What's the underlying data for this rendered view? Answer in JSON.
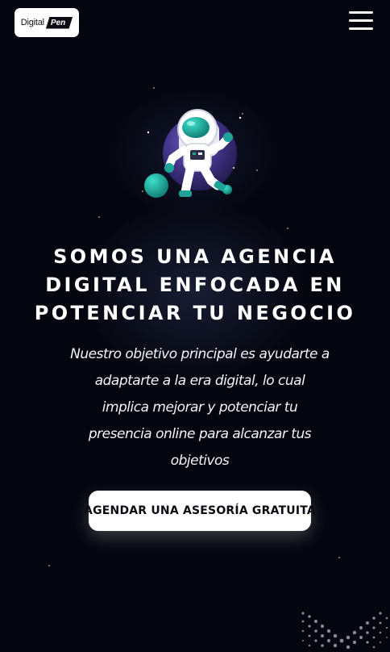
{
  "header": {
    "logo_text": "Digital",
    "logo_mark": "Pen",
    "menu_icon": "hamburger-menu-icon"
  },
  "hero": {
    "illustration": "astronaut-illustration",
    "headline_lines": [
      "SOMOS UNA AGENCIA",
      "DIGITAL ENFOCADA EN",
      "POTENCIAR TU NEGOCIO"
    ],
    "paragraph_lines": [
      "Nuestro objetivo principal es ayudarte a",
      "adaptarte a la era digital, lo cual",
      "implica mejorar y potenciar tu",
      "presencia online para alcanzar tus",
      "objetivos"
    ],
    "cta_label": "AGENDAR UNA ASESORÍA GRATUITA"
  },
  "colors": {
    "background": "#04060f",
    "accent_teal": "#1fa398",
    "accent_purple": "#4b3b8f",
    "button_bg": "#ffffff",
    "button_text": "#0a0a12"
  }
}
